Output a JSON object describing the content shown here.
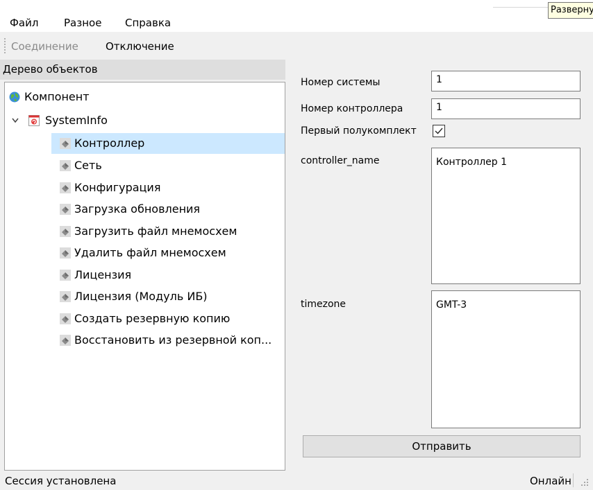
{
  "menu": [
    "Файл",
    "Разное",
    "Справка"
  ],
  "tooltip": "Развернуть",
  "toolbar": {
    "connect": "Соединение",
    "disconnect": "Отключение"
  },
  "tree": {
    "header": "Дерево объектов",
    "root": "Компонент",
    "group": "SystemInfo",
    "items": [
      "Контроллер",
      "Сеть",
      "Конфигурация",
      "Загрузка обновления",
      "Загрузить файл мнемосхем",
      "Удалить файл мнемосхем",
      "Лицензия",
      "Лицензия (Модуль ИБ)",
      "Создать резервную копию",
      "Восстановить из резервной коп..."
    ],
    "selected_index": 0
  },
  "form": {
    "system_number_label": "Номер системы",
    "system_number_value": "1",
    "controller_number_label": "Номер контроллера",
    "controller_number_value": "1",
    "first_half_label": "Первый полукомплект",
    "first_half_checked": true,
    "controller_name_label": "controller_name",
    "controller_name_value": "Контроллер 1",
    "timezone_label": "timezone",
    "timezone_value": "GMT-3",
    "submit_label": "Отправить"
  },
  "status": {
    "left": "Сессия установлена",
    "right": "Онлайн"
  },
  "colors": {
    "selection": "#cce8ff",
    "panel": "#f0f0f0",
    "header": "#dedede"
  },
  "icons": {
    "root": "globe-icon",
    "group": "systeminfo-icon",
    "item": "diamond-icon",
    "expand": "chevron-down-icon"
  }
}
